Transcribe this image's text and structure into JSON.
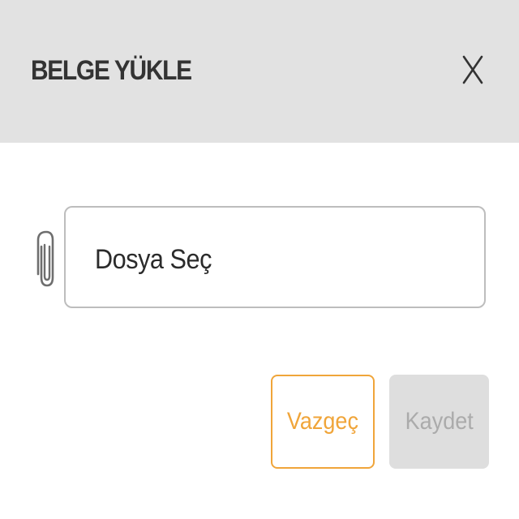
{
  "dialog": {
    "title": "BELGE YÜKLE",
    "close_label": "X"
  },
  "file_picker": {
    "icon": "paperclip-icon",
    "label": "Dosya Seç"
  },
  "actions": {
    "cancel_label": "Vazgeç",
    "save_label": "Kaydet",
    "save_enabled": false
  },
  "colors": {
    "header_background": "#e2e2e2",
    "accent": "#f0a53a",
    "disabled_background": "#dedede",
    "disabled_text": "#ababab"
  }
}
